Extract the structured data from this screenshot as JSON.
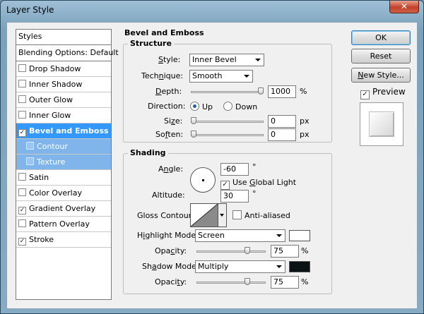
{
  "window": {
    "title": "Layer Style",
    "close_glyph": "✕"
  },
  "styles_panel": {
    "header": "Styles",
    "blending": "Blending Options: Default",
    "items": [
      {
        "label": "Drop Shadow",
        "checked": false
      },
      {
        "label": "Inner Shadow",
        "checked": false
      },
      {
        "label": "Outer Glow",
        "checked": false
      },
      {
        "label": "Inner Glow",
        "checked": false
      },
      {
        "label": "Bevel and Emboss",
        "checked": true
      },
      {
        "label": "Contour",
        "checked": false
      },
      {
        "label": "Texture",
        "checked": false
      },
      {
        "label": "Satin",
        "checked": false
      },
      {
        "label": "Color Overlay",
        "checked": false
      },
      {
        "label": "Gradient Overlay",
        "checked": true
      },
      {
        "label": "Pattern Overlay",
        "checked": false
      },
      {
        "label": "Stroke",
        "checked": true
      }
    ]
  },
  "bevel": {
    "section_title": "Bevel and Emboss",
    "structure": {
      "title": "Structure",
      "style_label": "Style:",
      "style_value": "Inner Bevel",
      "technique_label": "Technique:",
      "technique_value": "Smooth",
      "depth_label": "Depth:",
      "depth_value": "1000",
      "depth_unit": "%",
      "depth_fraction": 1.0,
      "direction_label": "Direction:",
      "direction_up": "Up",
      "direction_down": "Down",
      "direction_selected": "Up",
      "size_label": "Size:",
      "size_value": "0",
      "size_unit": "px",
      "soften_label": "Soften:",
      "soften_value": "0",
      "soften_unit": "px"
    },
    "shading": {
      "title": "Shading",
      "angle_label": "Angle:",
      "angle_value": "-60",
      "degree": "°",
      "use_global_light": "Use Global Light",
      "use_global_light_checked": true,
      "altitude_label": "Altitude:",
      "altitude_value": "30",
      "gloss_label": "Gloss Contour:",
      "anti_aliased": "Anti-aliased",
      "anti_aliased_checked": false,
      "highlight_mode_label": "Highlight Mode:",
      "highlight_mode_value": "Screen",
      "highlight_color": "#ffffff",
      "opacity_label": "Opacity:",
      "highlight_opacity": "75",
      "highlight_opacity_fraction": 0.75,
      "shadow_mode_label": "Shadow Mode:",
      "shadow_mode_value": "Multiply",
      "shadow_color": "#0a1216",
      "shadow_opacity": "75",
      "shadow_opacity_fraction": 0.75,
      "percent": "%"
    }
  },
  "buttons": {
    "ok": "OK",
    "reset": "Reset",
    "new_style": "New Style...",
    "preview": "Preview",
    "preview_checked": true
  }
}
